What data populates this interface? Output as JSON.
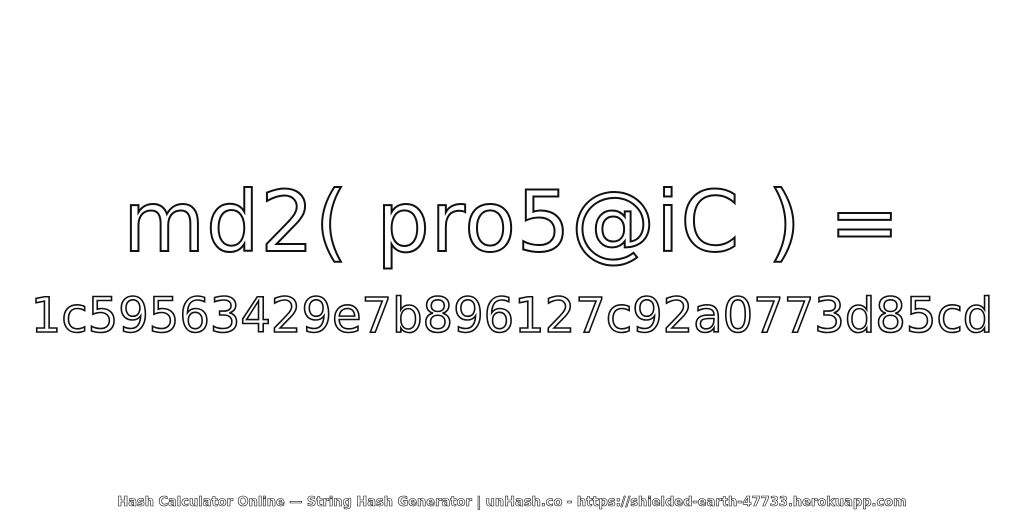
{
  "expression": "md2( pro5@iC ) =",
  "hash": "1c59563429e7b896127c92a0773d85cd",
  "footer": "Hash Calculator Online — String Hash Generator | unHash.co - https://shielded-earth-47733.herokuapp.com",
  "colors": {
    "background": "#ffffff",
    "text_fill": "#ffffff",
    "text_outline": "#111111"
  }
}
